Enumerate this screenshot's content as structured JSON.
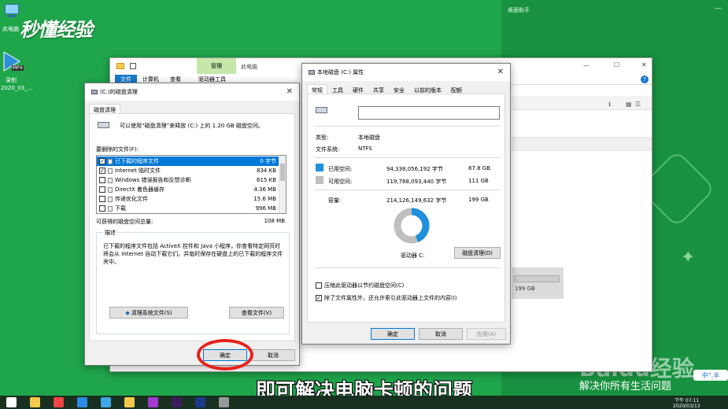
{
  "desktop": {
    "icon_thispc_label": "此电脑",
    "watermark_brand": "秒懂经验",
    "mp4_badge": "MP4",
    "recording_label_1": "录制",
    "recording_label_2": "2020_03_...",
    "assistant_title": "桌面助手",
    "baidu_brand": "Baidu经验",
    "baidu_slogan": "解决你所有生活问题",
    "ime_badge": "中°,半"
  },
  "explorer": {
    "qat_icon": "folder-icon",
    "tab_manage": "管理",
    "tab_thispc": "此电脑",
    "ribbon_tabs": [
      "文件",
      "计算机",
      "查看",
      "驱动器工具"
    ],
    "disk_fragment": "199 GB",
    "min": "—",
    "max": "☐",
    "close": "✕",
    "help": "?"
  },
  "cleanup": {
    "title": "(C:)的磁盘清理",
    "tab": "磁盘清理",
    "intro": "可以使用“磁盘清理”来释放 (C:) 上的 1.20 GB 磁盘空间。",
    "files_label": "要删除的文件(F):",
    "files": [
      {
        "name": "已下载的程序文件",
        "size": "0 字节",
        "checked": true,
        "selected": true
      },
      {
        "name": "Internet 临时文件",
        "size": "834 KB",
        "checked": true,
        "selected": false
      },
      {
        "name": "Windows 错误报告和反馈诊断",
        "size": "615 KB",
        "checked": false,
        "selected": false
      },
      {
        "name": "DirectX 着色器缓存",
        "size": "4.36 MB",
        "checked": false,
        "selected": false
      },
      {
        "name": "传递优化文件",
        "size": "15.6 MB",
        "checked": false,
        "selected": false
      },
      {
        "name": "下载",
        "size": "996 MB",
        "checked": false,
        "selected": false
      }
    ],
    "check_mark": "✓",
    "total_label": "可获得的磁盘空间总量:",
    "total_value": "108 MB",
    "desc_title": "描述",
    "desc_text": "已下载的程序文件包括 ActiveX 控件和 Java 小程序，你查看特定网页时将会从 Internet 自动下载它们。并临时保存在硬盘上的已下载的程序文件夹中。",
    "cleanup_sys_button": "清理系统文件(S)",
    "view_files_button": "查看文件(V)",
    "ok_button": "确定",
    "cancel_button": "取消"
  },
  "props": {
    "title": "本地磁盘 (C:) 属性",
    "tabs": [
      "常规",
      "工具",
      "硬件",
      "共享",
      "安全",
      "以前的版本",
      "配额"
    ],
    "type_label": "类型:",
    "type_value": "本地磁盘",
    "fs_label": "文件系统:",
    "fs_value": "NTFS",
    "used_label": "已用空间:",
    "used_bytes": "94,338,056,192 字节",
    "used_gb": "87.8 GB",
    "free_label": "可用空间:",
    "free_bytes": "119,788,093,440 字节",
    "free_gb": "111 GB",
    "cap_label": "容量:",
    "cap_bytes": "214,126,149,632 字节",
    "cap_gb": "199 GB",
    "drive_label": "驱动器 C:",
    "cleanup_button": "磁盘清理(D)",
    "compress_label": "压缩此驱动器以节约磁盘空间(C)",
    "index_label": "除了文件属性外，还允许索引此驱动器上文件的内容(I)",
    "ok_button": "确定",
    "cancel_button": "取消",
    "apply_button": "应用(A)",
    "used_fraction": 0.44,
    "used_color": "#1e90dc",
    "free_color": "#bfbfbf"
  },
  "subtitle": "即可解决电脑卡顿的问题",
  "taskbar": {
    "time": "下午 07:11",
    "date": "2020/03/13",
    "app_icons": [
      "start-icon",
      "file-explorer-icon",
      "chrome-icon",
      "browser-icon",
      "app-icon",
      "notes-icon",
      "media-icon",
      "premiere-icon",
      "video-icon",
      "tool-icon"
    ]
  }
}
